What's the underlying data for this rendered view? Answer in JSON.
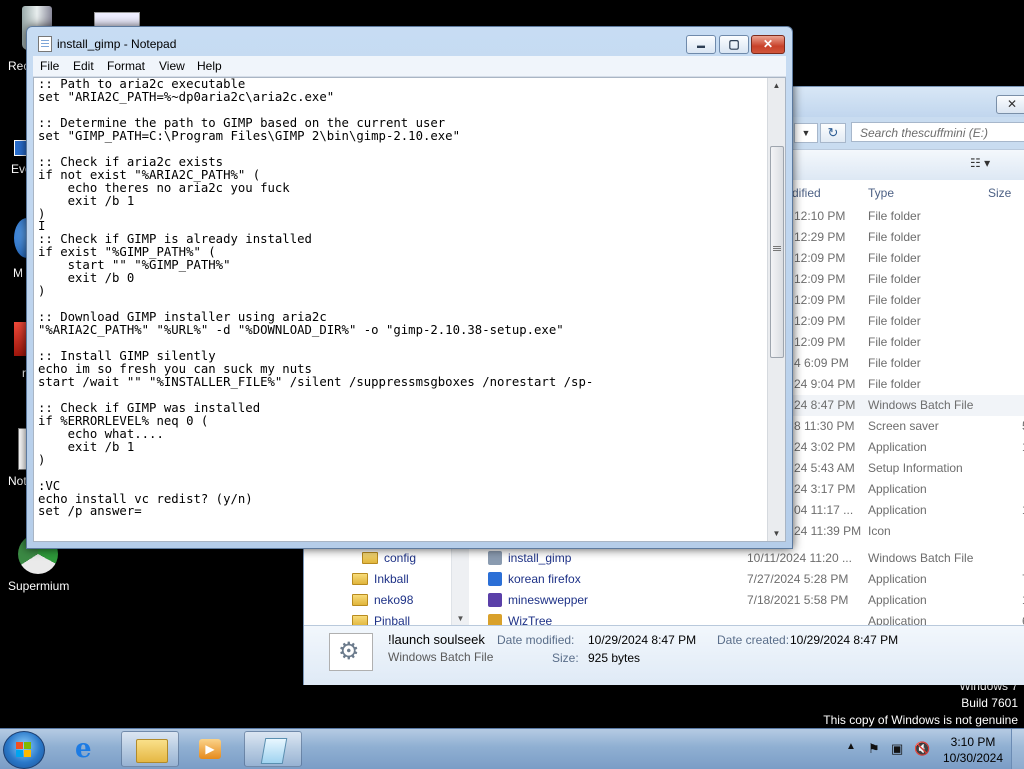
{
  "desktop": {
    "icons": [
      {
        "label": "Rec"
      },
      {
        "label": "Eve"
      },
      {
        "label": "M"
      },
      {
        "label": "r"
      },
      {
        "label": "Not"
      },
      {
        "label": "Supermium"
      }
    ],
    "watermark": {
      "line1": "Windows 7",
      "line2": "Build 7601",
      "line3": "This copy of Windows is not genuine"
    }
  },
  "notepad": {
    "title": "install_gimp - Notepad",
    "menu": [
      "File",
      "Edit",
      "Format",
      "View",
      "Help"
    ],
    "caption": {
      "minimize": "▬",
      "maximize": "▢",
      "close": "✕"
    },
    "content": ":: Path to aria2c executable\nset \"ARIA2C_PATH=%~dp0aria2c\\aria2c.exe\"\n\n:: Determine the path to GIMP based on the current user\nset \"GIMP_PATH=C:\\Program Files\\GIMP 2\\bin\\gimp-2.10.exe\"\n\n:: Check if aria2c exists\nif not exist \"%ARIA2C_PATH%\" (\n    echo theres no aria2c you fuck\n    exit /b 1\n)\nI\n:: Check if GIMP is already installed\nif exist \"%GIMP_PATH%\" (\n    start \"\" \"%GIMP_PATH%\"\n    exit /b 0\n)\n\n:: Download GIMP installer using aria2c\n\"%ARIA2C_PATH%\" \"%URL%\" -d \"%DOWNLOAD_DIR%\" -o \"gimp-2.10.38-setup.exe\"\n\n:: Install GIMP silently\necho im so fresh you can suck my nuts\nstart /wait \"\" \"%INSTALLER_FILE%\" /silent /suppressmsgboxes /norestart /sp-\n\n:: Check if GIMP was installed\nif %ERRORLEVEL% neq 0 (\n    echo what....\n    exit /b 1\n)\n\n:VC\necho install vc redist? (y/n)\nset /p answer="
  },
  "explorer": {
    "search_placeholder": "Search thescuffmini (E:)",
    "columns": {
      "modified": "dified",
      "type": "Type",
      "size": "Size"
    },
    "rows": [
      {
        "modified": "12:10 PM",
        "type": "File folder",
        "size": ""
      },
      {
        "modified": "12:29 PM",
        "type": "File folder",
        "size": ""
      },
      {
        "modified": "12:09 PM",
        "type": "File folder",
        "size": ""
      },
      {
        "modified": "12:09 PM",
        "type": "File folder",
        "size": ""
      },
      {
        "modified": "12:09 PM",
        "type": "File folder",
        "size": ""
      },
      {
        "modified": "12:09 PM",
        "type": "File folder",
        "size": ""
      },
      {
        "modified": "12:09 PM",
        "type": "File folder",
        "size": ""
      },
      {
        "modified": "4 6:09 PM",
        "type": "File folder",
        "size": ""
      },
      {
        "modified": "24 9:04 PM",
        "type": "File folder",
        "size": ""
      },
      {
        "modified": "24 8:47 PM",
        "type": "Windows Batch File",
        "size": ""
      },
      {
        "modified": "8 11:30 PM",
        "type": "Screen saver",
        "size": "5"
      },
      {
        "modified": "24 3:02 PM",
        "type": "Application",
        "size": "1,3"
      },
      {
        "modified": "24 5:43 AM",
        "type": "Setup Information",
        "size": ""
      },
      {
        "modified": "24 3:17 PM",
        "type": "Application",
        "size": ""
      },
      {
        "modified": "04 11:17 ...",
        "type": "Application",
        "size": "1,2"
      },
      {
        "modified": "24 11:39 PM",
        "type": "Icon",
        "size": ""
      }
    ],
    "full_rows": [
      {
        "name": "install_gimp",
        "modified": "10/11/2024 11:20 ...",
        "type": "Windows Batch File",
        "size": ""
      },
      {
        "name": "korean firefox",
        "modified": "7/27/2024 5:28 PM",
        "type": "Application",
        "size": "7,7"
      },
      {
        "name": "mineswwepper",
        "modified": "7/18/2021 5:58 PM",
        "type": "Application",
        "size": "1"
      },
      {
        "name": "WizTree",
        "modified": "",
        "type": "Application",
        "size": "6,5"
      }
    ],
    "nav": [
      "config",
      "Inkball",
      "neko98",
      "Pinball"
    ],
    "details": {
      "name": "!launch soulseek",
      "type": "Windows Batch File",
      "modified_label": "Date modified:",
      "modified_value": "10/29/2024 8:47 PM",
      "created_label": "Date created:",
      "created_value": "10/29/2024 8:47 PM",
      "size_label": "Size:",
      "size_value": "925 bytes"
    }
  },
  "taskbar": {
    "time": "3:10 PM",
    "date": "10/30/2024"
  }
}
